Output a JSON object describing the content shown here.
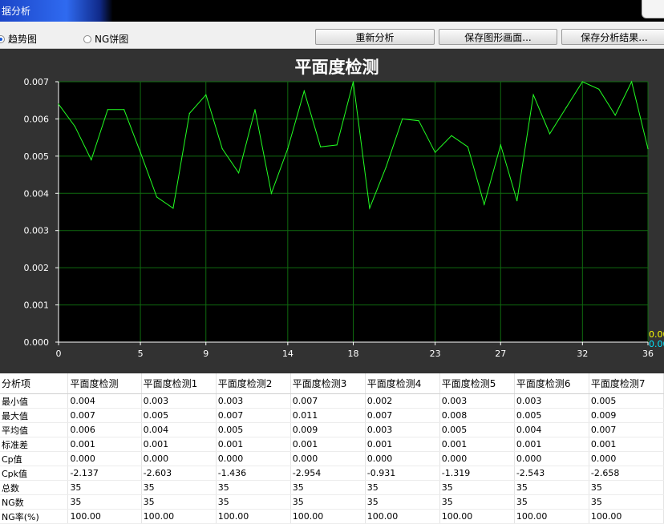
{
  "window": {
    "title": "据分析"
  },
  "toolbar": {
    "radio_trend": "趋势图",
    "radio_ng": "NG饼图",
    "btn_reanalyze": "重新分析",
    "btn_save_image": "保存图形画面...",
    "btn_save_result": "保存分析结果..."
  },
  "chart_data": {
    "type": "line",
    "title": "平面度检测",
    "xlabel": "",
    "ylabel": "",
    "x_ticks": [
      0,
      5,
      9,
      14,
      18,
      23,
      27,
      32,
      36
    ],
    "y_ticks": [
      "0.000",
      "0.001",
      "0.002",
      "0.003",
      "0.004",
      "0.005",
      "0.006",
      "0.007"
    ],
    "xlim": [
      0,
      36
    ],
    "ylim": [
      0,
      0.007
    ],
    "grid": true,
    "background": "#000000",
    "grid_color": "#0f6a0f",
    "line_color": "#22ff22",
    "right_edge_labels": [
      {
        "text": "0.00",
        "color": "#ffff00"
      },
      {
        "text": "0.00",
        "color": "#00e5ff"
      }
    ],
    "series": [
      {
        "x": [
          0,
          1,
          2,
          3,
          4,
          5,
          6,
          7,
          8,
          9,
          10,
          11,
          12,
          13,
          14,
          15,
          16,
          17,
          18,
          19,
          20,
          21,
          22,
          23,
          24,
          25,
          26,
          27,
          28,
          29,
          30,
          31,
          32,
          33,
          34,
          35,
          36
        ],
        "values": [
          0.0064,
          0.0058,
          0.0049,
          0.00625,
          0.00625,
          0.0051,
          0.0039,
          0.0036,
          0.00615,
          0.00665,
          0.0052,
          0.00455,
          0.00625,
          0.004,
          0.0052,
          0.00675,
          0.00525,
          0.0053,
          0.007,
          0.0036,
          0.0047,
          0.006,
          0.00595,
          0.0051,
          0.00555,
          0.00525,
          0.0037,
          0.0053,
          0.0038,
          0.00665,
          0.0056,
          0.0063,
          0.007,
          0.0068,
          0.0061,
          0.007,
          0.0052
        ]
      }
    ]
  },
  "table": {
    "columns": [
      "分析项",
      "平面度检测",
      "平面度检测1",
      "平面度检测2",
      "平面度检测3",
      "平面度检测4",
      "平面度检测5",
      "平面度检测6",
      "平面度检测7"
    ],
    "rows": [
      [
        "最小值",
        "0.004",
        "0.003",
        "0.003",
        "0.007",
        "0.002",
        "0.003",
        "0.003",
        "0.005"
      ],
      [
        "最大值",
        "0.007",
        "0.005",
        "0.007",
        "0.011",
        "0.007",
        "0.008",
        "0.005",
        "0.009"
      ],
      [
        "平均值",
        "0.006",
        "0.004",
        "0.005",
        "0.009",
        "0.003",
        "0.005",
        "0.004",
        "0.007"
      ],
      [
        "标准差",
        "0.001",
        "0.001",
        "0.001",
        "0.001",
        "0.001",
        "0.001",
        "0.001",
        "0.001"
      ],
      [
        "Cp值",
        "0.000",
        "0.000",
        "0.000",
        "0.000",
        "0.000",
        "0.000",
        "0.000",
        "0.000"
      ],
      [
        "Cpk值",
        "-2.137",
        "-2.603",
        "-1.436",
        "-2.954",
        "-0.931",
        "-1.319",
        "-2.543",
        "-2.658"
      ],
      [
        "总数",
        "35",
        "35",
        "35",
        "35",
        "35",
        "35",
        "35",
        "35"
      ],
      [
        "NG数",
        "35",
        "35",
        "35",
        "35",
        "35",
        "35",
        "35",
        "35"
      ],
      [
        "NG率(%)",
        "100.00",
        "100.00",
        "100.00",
        "100.00",
        "100.00",
        "100.00",
        "100.00",
        "100.00"
      ]
    ]
  }
}
